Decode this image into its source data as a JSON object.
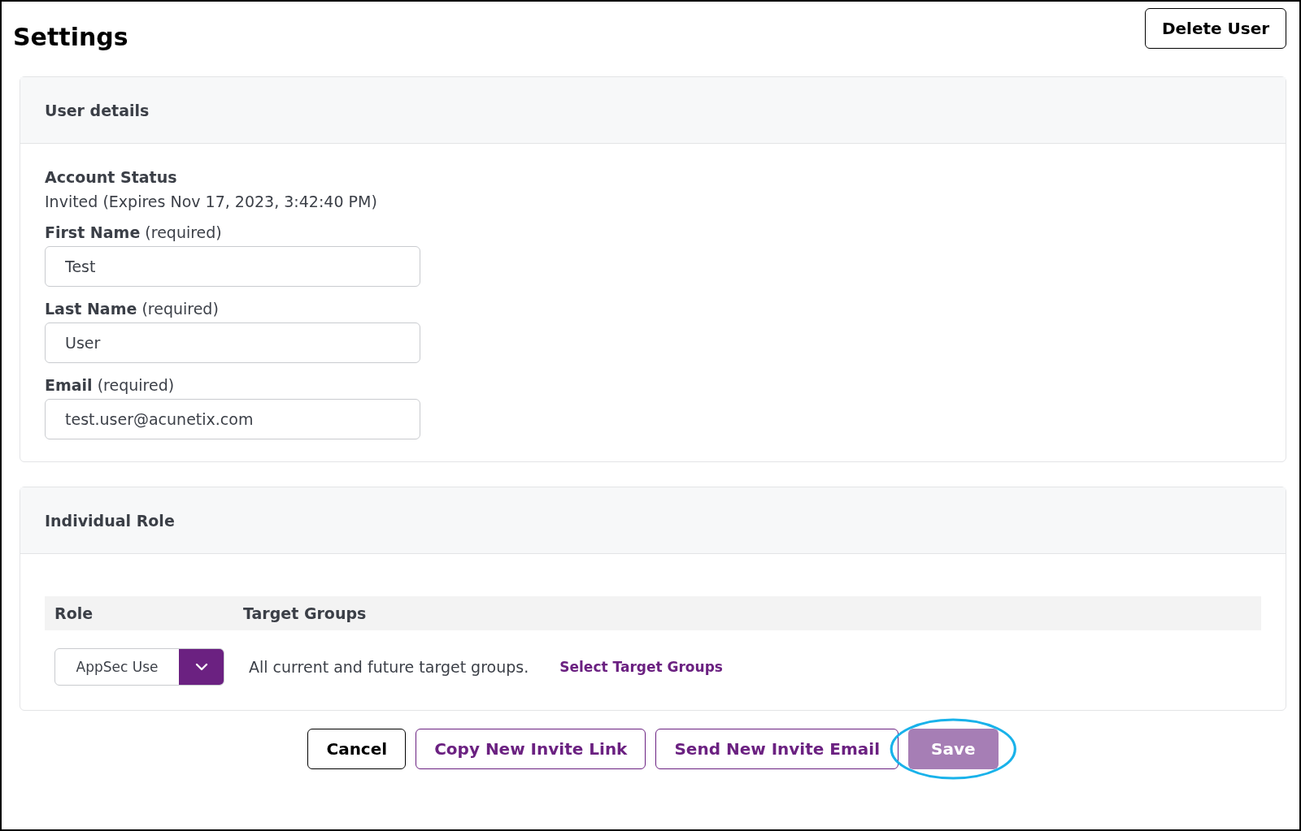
{
  "page": {
    "title": "Settings",
    "delete_button": "Delete User"
  },
  "user_details": {
    "title": "User details",
    "status_label": "Account Status",
    "status_value": "Invited (Expires Nov 17, 2023, 3:42:40 PM)",
    "fields": [
      {
        "label": "**First Name** (required)",
        "value": "Test"
      },
      {
        "label": "**Last Name** (required)",
        "value": "User"
      },
      {
        "label": "**Email** (required)",
        "value": "test.user@acunetix.com"
      }
    ]
  },
  "individual_role": {
    "title": "Individual Role",
    "columns": [
      "Role",
      "Target Groups"
    ],
    "role_select": {
      "value": "AppSec Use"
    },
    "target_text": "All current and future target groups.",
    "target_link": "Select Target Groups"
  },
  "footer_buttons": [
    {
      "label": "Cancel",
      "kind": "plain",
      "disabled": false,
      "highlighted": false
    },
    {
      "label": "Copy New Invite Link",
      "kind": "outline",
      "disabled": false,
      "highlighted": false
    },
    {
      "label": "Send New Invite Email",
      "kind": "outline",
      "disabled": false,
      "highlighted": false
    },
    {
      "label": "Save",
      "kind": "primary",
      "disabled": true,
      "highlighted": true
    }
  ]
}
